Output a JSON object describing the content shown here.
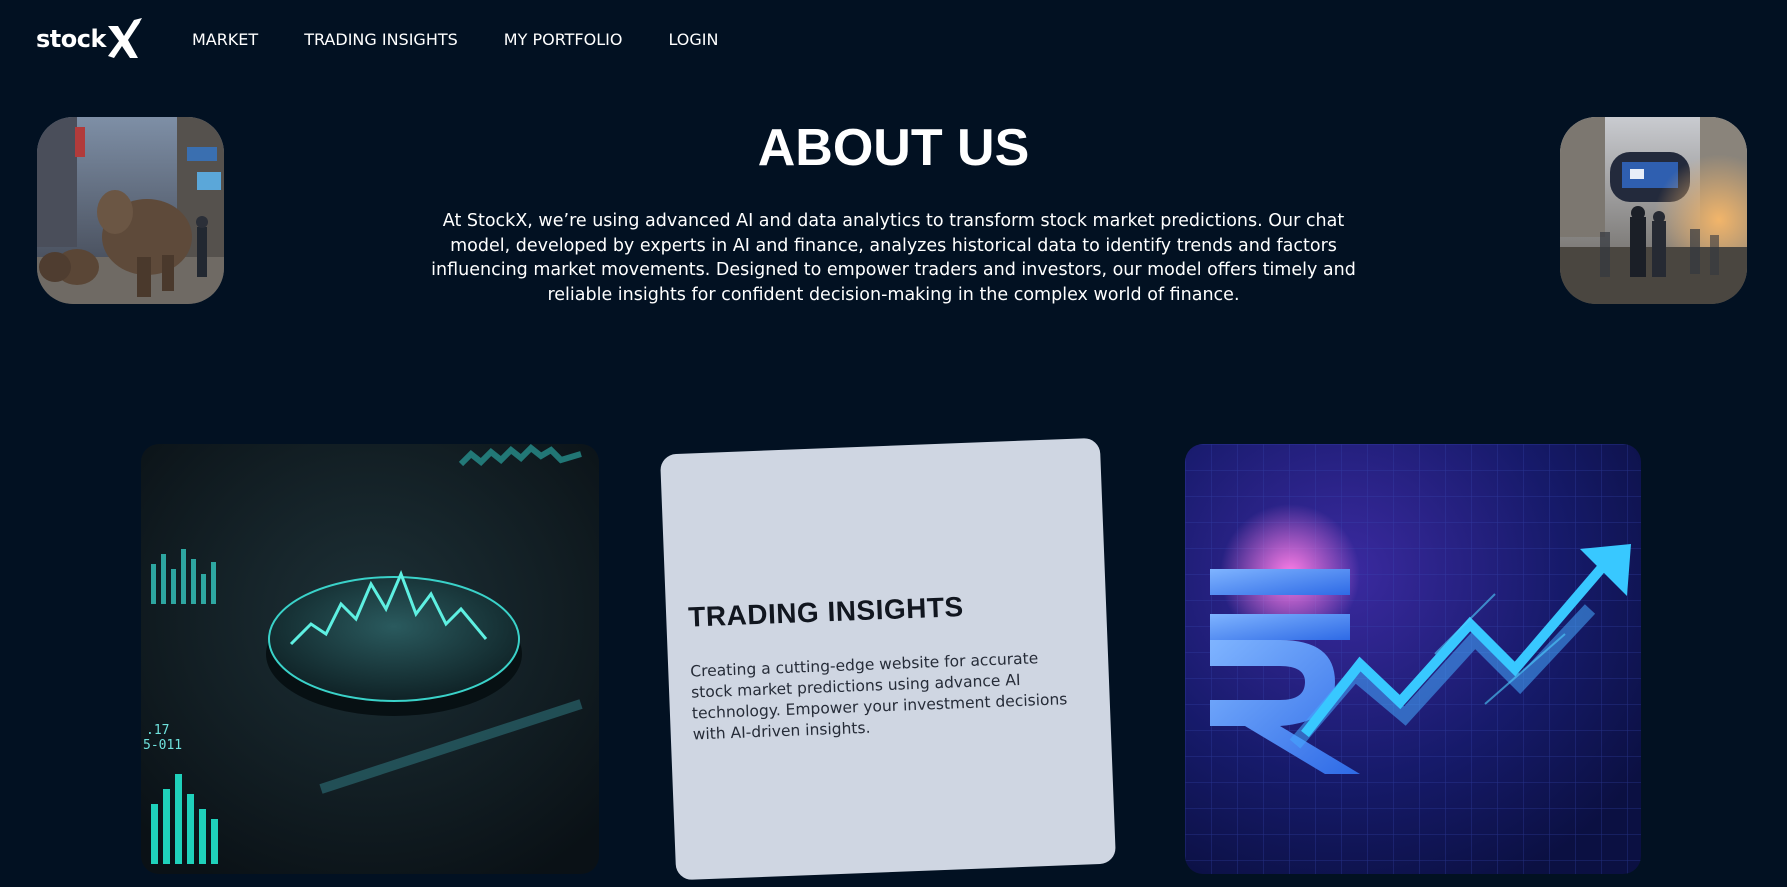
{
  "brand": {
    "name": "stock",
    "mark": "X"
  },
  "nav": {
    "items": [
      {
        "label": "MARKET"
      },
      {
        "label": "TRADING INSIGHTS"
      },
      {
        "label": "MY PORTFOLIO"
      },
      {
        "label": "LOGIN"
      }
    ]
  },
  "about": {
    "title": "ABOUT US",
    "description": "At StockX, we’re using advanced AI and data analytics to transform stock market predictions. Our chat model, developed by experts in AI and finance, analyzes historical data to identify trends and factors influencing market movements. Designed to empower traders and investors, our model offers timely and reliable insights for confident decision-making in the complex world of finance."
  },
  "card": {
    "title": "TRADING INSIGHTS",
    "text": "Creating a cutting-edge website for accurate stock market predictions using advance AI technology. Empower your investment decisions with AI-driven insights."
  },
  "colors": {
    "background": "#021122",
    "card_bg": "#cfd6e2",
    "accent_cyan": "#3fd8d8",
    "accent_magenta": "#e040c0"
  }
}
